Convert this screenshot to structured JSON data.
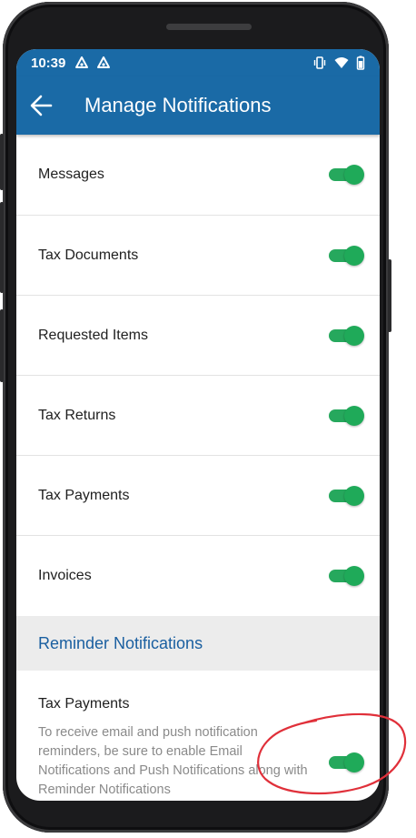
{
  "status_bar": {
    "time": "10:39",
    "icons_left": [
      "notification-a-icon",
      "notification-a-icon"
    ],
    "icons_right": [
      "vibrate-icon",
      "wifi-icon",
      "battery-icon"
    ]
  },
  "app_bar": {
    "title": "Manage Notifications",
    "back_icon": "arrow-left-icon",
    "color": "#1a6aa6"
  },
  "notifications": [
    {
      "label": "Messages",
      "enabled": true
    },
    {
      "label": "Tax Documents",
      "enabled": true
    },
    {
      "label": "Requested Items",
      "enabled": true
    },
    {
      "label": "Tax Returns",
      "enabled": true
    },
    {
      "label": "Tax Payments",
      "enabled": true
    },
    {
      "label": "Invoices",
      "enabled": true
    }
  ],
  "reminder_section": {
    "title": "Reminder Notifications",
    "items": [
      {
        "label": "Tax Payments",
        "description": "To receive email and push notification reminders, be sure to enable Email Notifications and Push Notifications along with Reminder Notifications",
        "enabled": true
      }
    ]
  },
  "colors": {
    "toggle_on": "#1faa59",
    "section_title": "#1a5fa0",
    "annotation": "#e0303a"
  }
}
